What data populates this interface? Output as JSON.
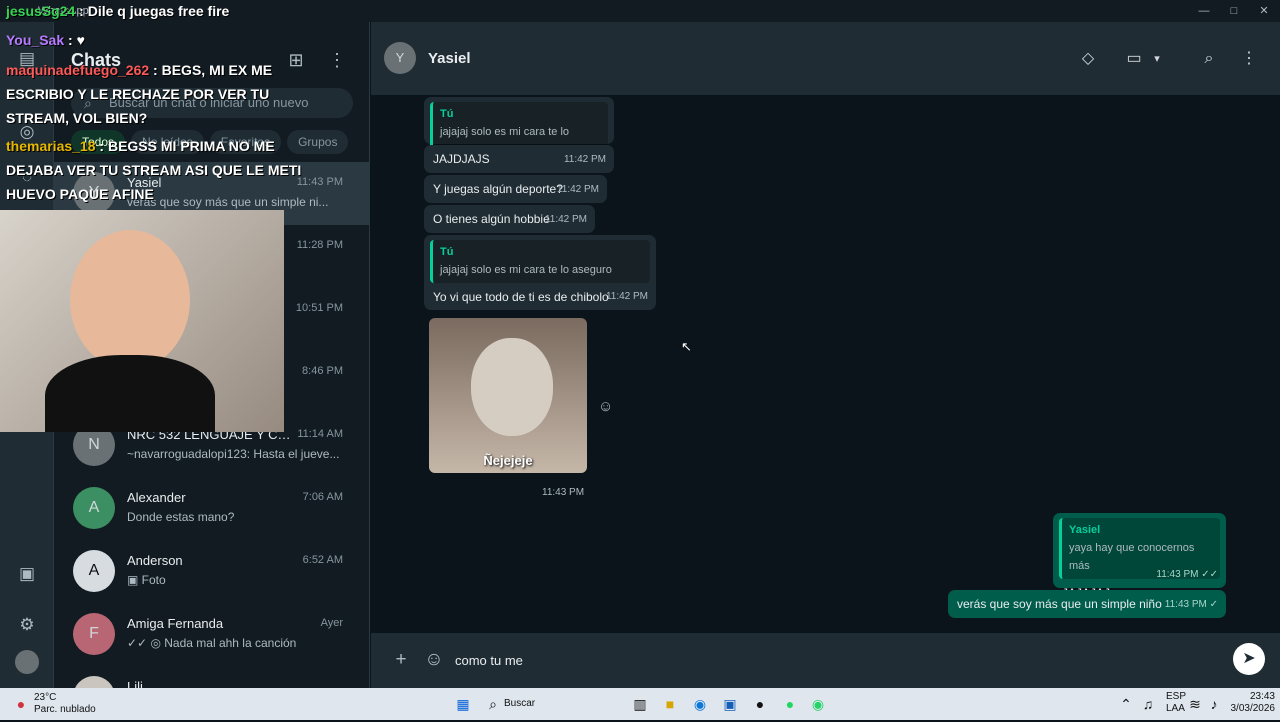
{
  "app": {
    "title": "WhatsApp"
  },
  "window": {
    "minimize": "—",
    "maximize": "□",
    "close": "✕"
  },
  "rail": {
    "icons": [
      {
        "name": "chats-icon",
        "glyph": "▤"
      },
      {
        "name": "status-icon",
        "glyph": "◎"
      },
      {
        "name": "communities-icon",
        "glyph": "◌"
      },
      {
        "name": "archive-icon",
        "glyph": "▣"
      },
      {
        "name": "settings-icon",
        "glyph": "⚙"
      }
    ]
  },
  "sidebar": {
    "title": "Chats",
    "new_chat": "⊞",
    "menu": "⋮",
    "search_placeholder": "Buscar un chat o iniciar uno nuevo",
    "filters": [
      "Todos",
      "No leídos",
      "Favoritos",
      "Grupos"
    ],
    "chats": [
      {
        "name": "Yasiel",
        "time": "11:43 PM",
        "preview": "verás que soy más que un simple ni...",
        "initial": "Y"
      },
      {
        "name": "",
        "time": "11:28 PM",
        "preview": "",
        "initial": ""
      },
      {
        "name": "",
        "time": "10:51 PM",
        "preview": "",
        "initial": ""
      },
      {
        "name": "",
        "time": "8:46 PM",
        "preview": "",
        "initial": ""
      },
      {
        "name": "NRC 532 LENGUAJE Y CO...",
        "time": "11:14 AM",
        "preview": "~navarroguadalopi123: Hasta el jueve...",
        "initial": "N"
      },
      {
        "name": "Alexander",
        "time": "7:06 AM",
        "preview": "Donde estas mano?",
        "initial": "A"
      },
      {
        "name": "Anderson",
        "time": "6:52 AM",
        "preview": "▣ Foto",
        "initial": "A"
      },
      {
        "name": "Amiga Fernanda",
        "time": "Ayer",
        "preview": "✓✓ ◎ Nada mal ahh la canción",
        "initial": "F"
      },
      {
        "name": "Lili",
        "time": "",
        "preview": "",
        "initial": "L"
      }
    ]
  },
  "header": {
    "name": "Yasiel",
    "initial": "Y",
    "label_icon": "◇",
    "video_icon": "▭",
    "dropdown": "▾",
    "search_icon": "⌕",
    "menu": "⋮"
  },
  "messages": [
    {
      "id": "m1",
      "type": "in",
      "quote_name": "Tú",
      "quote_text": "jajajaj solo es mi cara te lo aseguro",
      "text": "",
      "time": ""
    },
    {
      "id": "m2",
      "type": "in",
      "text": "JAJDJAJS",
      "time": "11:42 PM"
    },
    {
      "id": "m3",
      "type": "in",
      "text": "Y juegas algún deporte?",
      "time": "11:42 PM"
    },
    {
      "id": "m4",
      "type": "in",
      "text": "O tienes algún hobbie",
      "time": "11:42 PM"
    },
    {
      "id": "m5",
      "type": "in",
      "quote_name": "Tú",
      "quote_text": "jajajaj solo es mi cara te lo aseguro",
      "text": "Yo vi que todo de ti es de chibolo",
      "time": "11:42 PM"
    },
    {
      "id": "m6",
      "type": "out",
      "quote_name": "Yasiel",
      "quote_text": "yaya hay que conocernos más",
      "text": "JAJAJAJ vaa",
      "time": "11:43 PM ✓✓"
    },
    {
      "id": "m7",
      "type": "out",
      "text": "verás que soy más que un simple niño",
      "time": "11:43 PM ✓"
    }
  ],
  "sticker": {
    "caption": "Ñejejeje",
    "time": "11:43 PM",
    "reaction": "☺"
  },
  "composer": {
    "plus": "+",
    "emoji": "☺",
    "value": "como tu me ",
    "send": "➤"
  },
  "overlay": {
    "lines": [
      {
        "user": "jesusSg24",
        "sep": ":",
        "text": "Dile q juegas free fire",
        "color": "#39d353"
      },
      {
        "user": "You_Sak",
        "sep": ":",
        "text": "♥",
        "color": "#b77bff"
      },
      {
        "user": "maquinadefuego_262",
        "sep": ":",
        "text": "BEGS, MI EX ME ESCRIBIO Y LE RECHAZE POR VER TU STREAM, VOL BIEN?",
        "color": "#ff5a5a"
      },
      {
        "user": "themarias_18",
        "sep": ":",
        "text": "BEGSS MI PRIMA NO ME DEJABA VER TU STREAM ASI QUE LE METI HUEVO PAQUE AFINE",
        "color": "#e7b800"
      }
    ]
  },
  "taskbar": {
    "weather": "23°C",
    "weather_desc": "Parc. nublado",
    "search": "Buscar",
    "lang1": "ESP",
    "lang2": "LAA",
    "time": "23:43",
    "date": "3/03/2026"
  }
}
